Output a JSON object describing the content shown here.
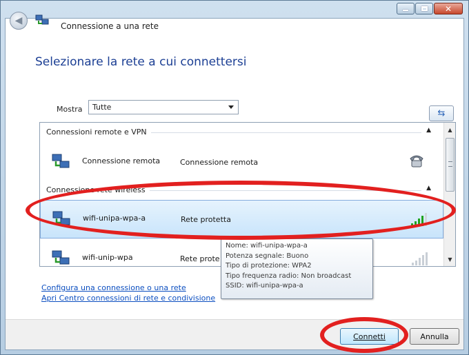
{
  "window": {
    "title": "Connessione a una rete",
    "controls": {
      "minimize": "minimize",
      "maximize": "maximize",
      "close": "close"
    }
  },
  "header": {
    "back_icon": "back-arrow-icon",
    "network_icon": "network-icon"
  },
  "heading": "Selezionare la rete a cui connettersi",
  "filter": {
    "label": "Mostra",
    "selected": "Tutte"
  },
  "refresh_icon": "refresh-icon",
  "groups": [
    {
      "title": "Connessioni remote e VPN"
    },
    {
      "title": "Connessione rete wireless"
    }
  ],
  "networks": [
    {
      "name": "Connessione remota",
      "status": "Connessione remota",
      "icon": "phone-icon"
    },
    {
      "name": "wifi-unipa-wpa-a",
      "status": "Rete protetta",
      "icon": "signal-strength-icon",
      "selected": true
    },
    {
      "name": "wifi-unip-wpa",
      "status": "Rete prote",
      "icon": "signal-strength-icon"
    }
  ],
  "tooltip": {
    "name": "Nome: wifi-unipa-wpa-a",
    "signal": "Potenza segnale: Buono",
    "security": "Tipo di protezione: WPA2",
    "radio": "Tipo frequenza radio: Non broadcast",
    "ssid": "SSID: wifi-unipa-wpa-a"
  },
  "links": {
    "setup": "Configura una connessione o una rete",
    "center": "Apri Centro connessioni di rete e condivisione"
  },
  "buttons": {
    "connect": "Connetti",
    "cancel": "Annulla"
  },
  "colors": {
    "heading": "#1c3f94",
    "link": "#0b4ec0",
    "annotation": "#e2201f",
    "signal": "#1fa31f"
  }
}
